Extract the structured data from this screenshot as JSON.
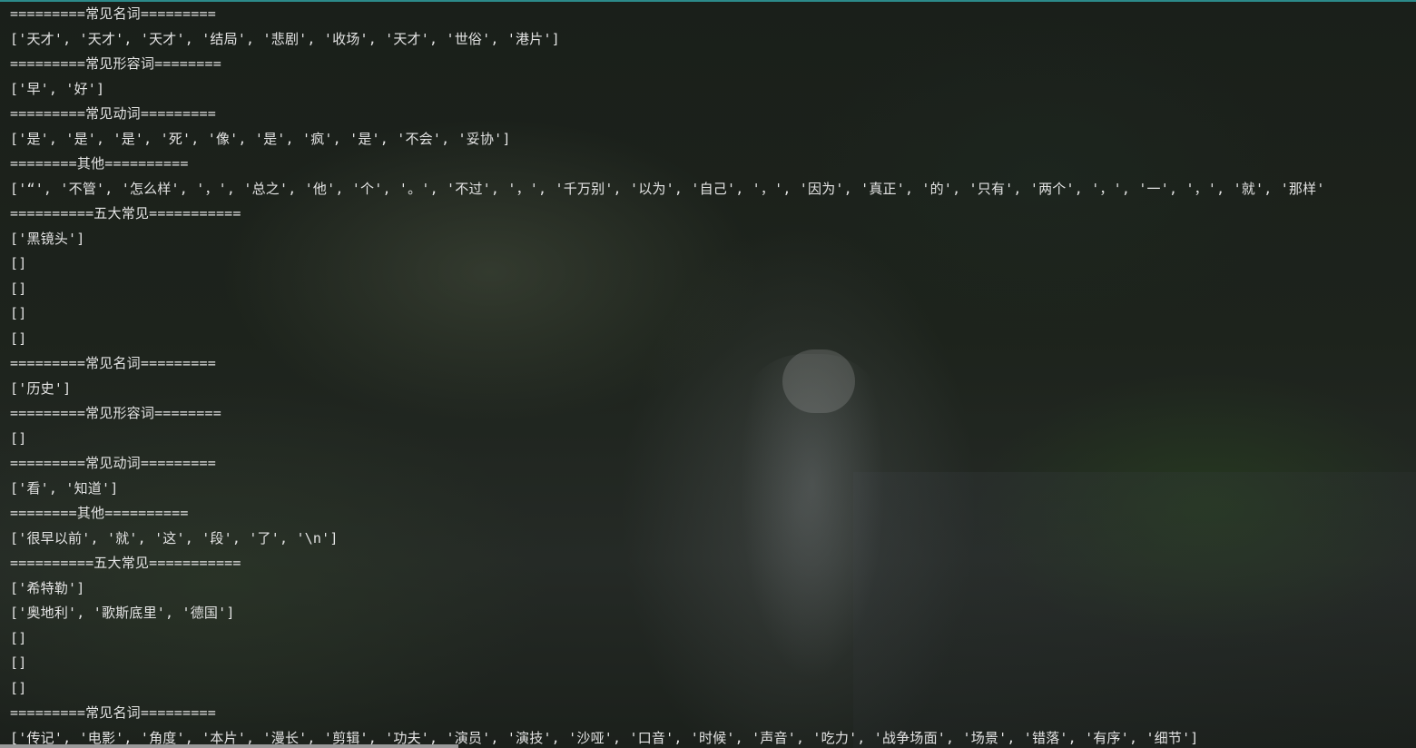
{
  "output_lines": [
    "=========常见名词=========",
    "['天才', '天才', '天才', '结局', '悲剧', '收场', '天才', '世俗', '港片']",
    "=========常见形容词========",
    "['早', '好']",
    "=========常见动词=========",
    "['是', '是', '是', '死', '像', '是', '疯', '是', '不会', '妥协']",
    "========其他==========",
    "['“', '不管', '怎么样', '，', '总之', '他', '个', '。', '不过', '，', '千万别', '以为', '自己', '，', '因为', '真正', '的', '只有', '两个', '，', '一', '，', '就', '那样'",
    "==========五大常见===========",
    "['黑镜头']",
    "[]",
    "[]",
    "[]",
    "[]",
    "=========常见名词=========",
    "['历史']",
    "=========常见形容词========",
    "[]",
    "=========常见动词=========",
    "['看', '知道']",
    "========其他==========",
    "['很早以前', '就', '这', '段', '了', '\\n']",
    "==========五大常见===========",
    "['希特勒']",
    "['奥地利', '歌斯底里', '德国']",
    "[]",
    "[]",
    "[]",
    "=========常见名词=========",
    "['传记', '电影', '角度', '本片', '漫长', '剪辑', '功夫', '演员', '演技', '沙哑', '口音', '时候', '声音', '吃力', '战争场面', '场景', '错落', '有序', '细节']"
  ],
  "colors": {
    "text": "#e4e4e4",
    "background": "#1d231c",
    "top_strip": "#2c8a8a",
    "scrollbar": "#9a9a9a"
  }
}
